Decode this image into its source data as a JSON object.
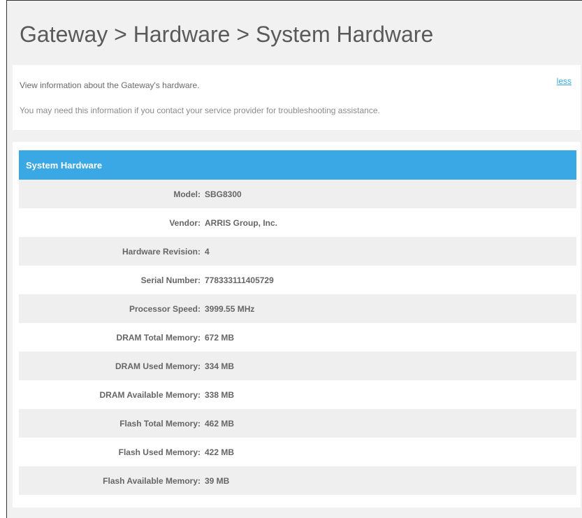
{
  "header": {
    "title": "Gateway > Hardware > System Hardware"
  },
  "info": {
    "line1": "View information about the Gateway's hardware.",
    "line2": "You may need this information if you contact your service provider for troubleshooting assistance.",
    "less_link": "less"
  },
  "panel": {
    "title": "System Hardware",
    "rows": [
      {
        "label": "Model:",
        "value": "SBG8300"
      },
      {
        "label": "Vendor:",
        "value": "ARRIS Group, Inc."
      },
      {
        "label": "Hardware Revision:",
        "value": "4"
      },
      {
        "label": "Serial Number:",
        "value": "778333111405729"
      },
      {
        "label": "Processor Speed:",
        "value": "3999.55 MHz"
      },
      {
        "label": "DRAM Total Memory:",
        "value": "672 MB"
      },
      {
        "label": "DRAM Used Memory:",
        "value": "334 MB"
      },
      {
        "label": "DRAM Available Memory:",
        "value": "338 MB"
      },
      {
        "label": "Flash Total Memory:",
        "value": "462 MB"
      },
      {
        "label": "Flash Used Memory:",
        "value": "422 MB"
      },
      {
        "label": "Flash Available Memory:",
        "value": "39 MB"
      }
    ]
  },
  "colors": {
    "accent": "#3ba8e6",
    "link": "#3aa8de"
  }
}
